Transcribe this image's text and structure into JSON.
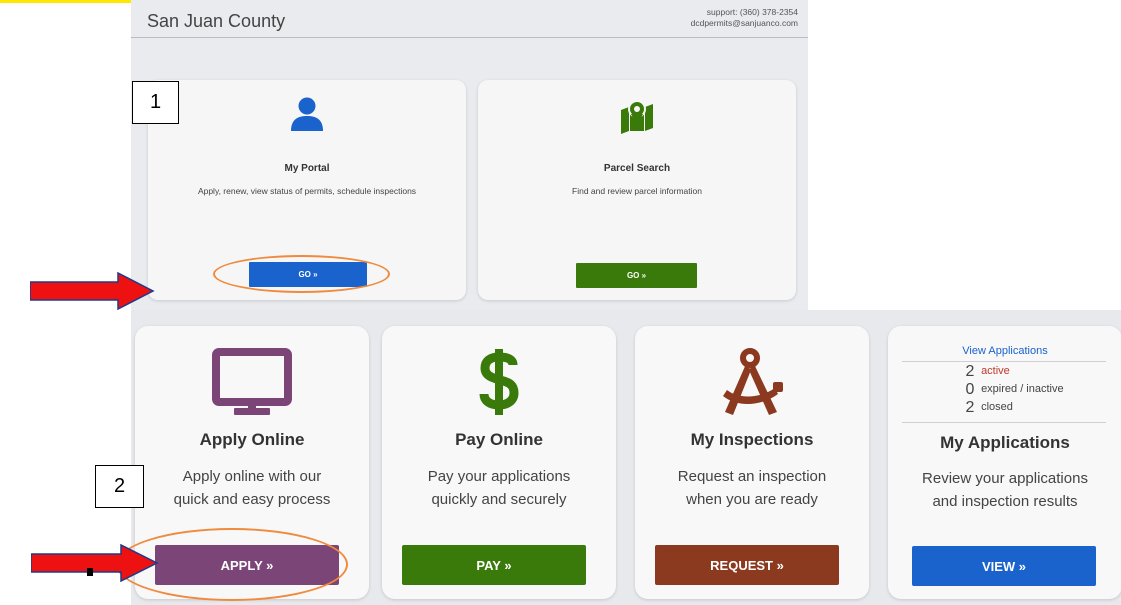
{
  "top_header": {
    "title": "San Juan County",
    "support_phone": "support: (360) 378-2354",
    "support_email": "dcdpermits@sanjuanco.com"
  },
  "top_cards": [
    {
      "icon": "person-icon",
      "title": "My Portal",
      "description": "Apply, renew, view status of permits, schedule inspections",
      "button": "GO »",
      "color": "#1a62cc"
    },
    {
      "icon": "map-pin-icon",
      "title": "Parcel Search",
      "description": "Find and review parcel information",
      "button": "GO »",
      "color": "#3a7a0a"
    }
  ],
  "bottom_cards": [
    {
      "icon": "monitor-icon",
      "title": "Apply Online",
      "description_line1": "Apply online with our",
      "description_line2": "quick and easy process",
      "button": "APPLY »",
      "color": "#7b4578"
    },
    {
      "icon": "dollar-icon",
      "title": "Pay Online",
      "description_line1": "Pay your applications",
      "description_line2": "quickly and securely",
      "button": "PAY »",
      "color": "#3a7a0a"
    },
    {
      "icon": "compass-icon",
      "title": "My Inspections",
      "description_line1": "Request an inspection",
      "description_line2": "when you are ready",
      "button": "REQUEST »",
      "color": "#8b3a1f"
    },
    {
      "icon": "applications-icon",
      "title": "My Applications",
      "description_line1": "Review your applications",
      "description_line2": "and inspection results",
      "button": "VIEW »",
      "color": "#1a62cc"
    }
  ],
  "applications_summary": {
    "link": "View Applications",
    "rows": [
      {
        "count": "2",
        "label": "active"
      },
      {
        "count": "0",
        "label": "expired / inactive"
      },
      {
        "count": "2",
        "label": "closed"
      }
    ]
  },
  "annotations": {
    "step1": "1",
    "step2": "2",
    "arrow_color": "#ee1111",
    "highlight_color": "#f08a3c"
  }
}
